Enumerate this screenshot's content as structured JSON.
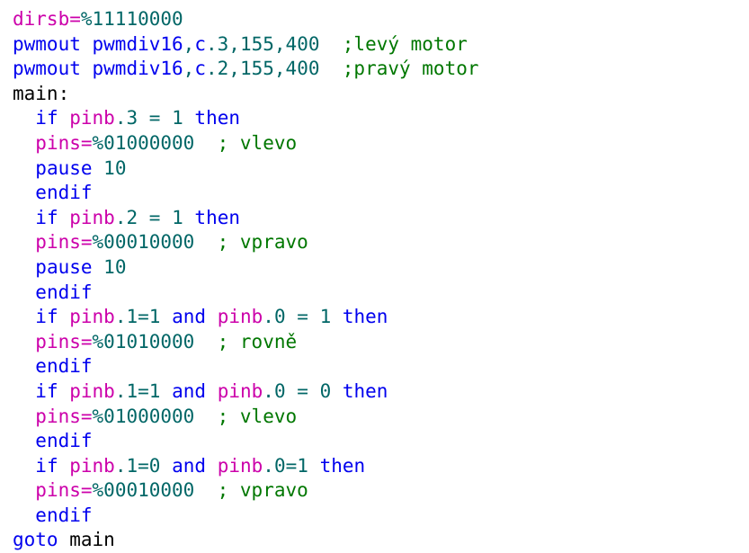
{
  "editor": {
    "language": "PICAXE BASIC",
    "background_color": "#ffffff",
    "font_size_px": 21,
    "line_height_px": 27.6,
    "colors": {
      "plain": "#000000",
      "keyword": "#0000EE",
      "identifier": "#CC00AA",
      "number": "#006666",
      "comment": "#007700"
    }
  },
  "code": {
    "line_count": 21,
    "lines": [
      {
        "n": 1,
        "text": "dirsb=%11110000",
        "tokens": [
          {
            "t": "dirsb",
            "c": "ident"
          },
          {
            "t": "=",
            "c": "ident"
          },
          {
            "t": "%11110000",
            "c": "number"
          }
        ]
      },
      {
        "n": 2,
        "text": "pwmout pwmdiv16,c.3,155,400  ;levý motor",
        "tokens": [
          {
            "t": "pwmout",
            "c": "keyword"
          },
          {
            "t": " ",
            "c": "plain"
          },
          {
            "t": "pwmdiv16",
            "c": "keyword"
          },
          {
            "t": ",",
            "c": "number"
          },
          {
            "t": "c",
            "c": "keyword"
          },
          {
            "t": ".",
            "c": "number"
          },
          {
            "t": "3",
            "c": "number"
          },
          {
            "t": ",",
            "c": "number"
          },
          {
            "t": "155",
            "c": "number"
          },
          {
            "t": ",",
            "c": "number"
          },
          {
            "t": "400",
            "c": "number"
          },
          {
            "t": "  ",
            "c": "plain"
          },
          {
            "t": ";levý motor",
            "c": "comment"
          }
        ]
      },
      {
        "n": 3,
        "text": "pwmout pwmdiv16,c.2,155,400  ;pravý motor",
        "tokens": [
          {
            "t": "pwmout",
            "c": "keyword"
          },
          {
            "t": " ",
            "c": "plain"
          },
          {
            "t": "pwmdiv16",
            "c": "keyword"
          },
          {
            "t": ",",
            "c": "number"
          },
          {
            "t": "c",
            "c": "keyword"
          },
          {
            "t": ".",
            "c": "number"
          },
          {
            "t": "2",
            "c": "number"
          },
          {
            "t": ",",
            "c": "number"
          },
          {
            "t": "155",
            "c": "number"
          },
          {
            "t": ",",
            "c": "number"
          },
          {
            "t": "400",
            "c": "number"
          },
          {
            "t": "  ",
            "c": "plain"
          },
          {
            "t": ";pravý motor",
            "c": "comment"
          }
        ]
      },
      {
        "n": 4,
        "text": "main:",
        "tokens": [
          {
            "t": "main:",
            "c": "plain"
          }
        ]
      },
      {
        "n": 5,
        "text": "  if pinb.3 = 1 then",
        "tokens": [
          {
            "t": "  ",
            "c": "plain"
          },
          {
            "t": "if",
            "c": "keyword"
          },
          {
            "t": " ",
            "c": "plain"
          },
          {
            "t": "pinb",
            "c": "ident"
          },
          {
            "t": ".",
            "c": "number"
          },
          {
            "t": "3",
            "c": "number"
          },
          {
            "t": " ",
            "c": "plain"
          },
          {
            "t": "=",
            "c": "number"
          },
          {
            "t": " ",
            "c": "plain"
          },
          {
            "t": "1",
            "c": "number"
          },
          {
            "t": " ",
            "c": "plain"
          },
          {
            "t": "then",
            "c": "keyword"
          }
        ]
      },
      {
        "n": 6,
        "text": "  pins=%01000000  ; vlevo",
        "tokens": [
          {
            "t": "  ",
            "c": "plain"
          },
          {
            "t": "pins",
            "c": "ident"
          },
          {
            "t": "=",
            "c": "ident"
          },
          {
            "t": "%01000000",
            "c": "number"
          },
          {
            "t": "  ",
            "c": "plain"
          },
          {
            "t": "; vlevo",
            "c": "comment"
          }
        ]
      },
      {
        "n": 7,
        "text": "  pause 10",
        "tokens": [
          {
            "t": "  ",
            "c": "plain"
          },
          {
            "t": "pause",
            "c": "keyword"
          },
          {
            "t": " ",
            "c": "plain"
          },
          {
            "t": "10",
            "c": "number"
          }
        ]
      },
      {
        "n": 8,
        "text": "  endif",
        "tokens": [
          {
            "t": "  ",
            "c": "plain"
          },
          {
            "t": "endif",
            "c": "keyword"
          }
        ]
      },
      {
        "n": 9,
        "text": "  if pinb.2 = 1 then",
        "tokens": [
          {
            "t": "  ",
            "c": "plain"
          },
          {
            "t": "if",
            "c": "keyword"
          },
          {
            "t": " ",
            "c": "plain"
          },
          {
            "t": "pinb",
            "c": "ident"
          },
          {
            "t": ".",
            "c": "number"
          },
          {
            "t": "2",
            "c": "number"
          },
          {
            "t": " ",
            "c": "plain"
          },
          {
            "t": "=",
            "c": "number"
          },
          {
            "t": " ",
            "c": "plain"
          },
          {
            "t": "1",
            "c": "number"
          },
          {
            "t": " ",
            "c": "plain"
          },
          {
            "t": "then",
            "c": "keyword"
          }
        ]
      },
      {
        "n": 10,
        "text": "  pins=%00010000  ; vpravo",
        "tokens": [
          {
            "t": "  ",
            "c": "plain"
          },
          {
            "t": "pins",
            "c": "ident"
          },
          {
            "t": "=",
            "c": "ident"
          },
          {
            "t": "%00010000",
            "c": "number"
          },
          {
            "t": "  ",
            "c": "plain"
          },
          {
            "t": "; vpravo",
            "c": "comment"
          }
        ]
      },
      {
        "n": 11,
        "text": "  pause 10",
        "tokens": [
          {
            "t": "  ",
            "c": "plain"
          },
          {
            "t": "pause",
            "c": "keyword"
          },
          {
            "t": " ",
            "c": "plain"
          },
          {
            "t": "10",
            "c": "number"
          }
        ]
      },
      {
        "n": 12,
        "text": "  endif",
        "tokens": [
          {
            "t": "  ",
            "c": "plain"
          },
          {
            "t": "endif",
            "c": "keyword"
          }
        ]
      },
      {
        "n": 13,
        "text": "  if pinb.1=1 and pinb.0 = 1 then",
        "tokens": [
          {
            "t": "  ",
            "c": "plain"
          },
          {
            "t": "if",
            "c": "keyword"
          },
          {
            "t": " ",
            "c": "plain"
          },
          {
            "t": "pinb",
            "c": "ident"
          },
          {
            "t": ".",
            "c": "number"
          },
          {
            "t": "1",
            "c": "number"
          },
          {
            "t": "=",
            "c": "number"
          },
          {
            "t": "1",
            "c": "number"
          },
          {
            "t": " ",
            "c": "plain"
          },
          {
            "t": "and",
            "c": "keyword"
          },
          {
            "t": " ",
            "c": "plain"
          },
          {
            "t": "pinb",
            "c": "ident"
          },
          {
            "t": ".",
            "c": "number"
          },
          {
            "t": "0",
            "c": "number"
          },
          {
            "t": " ",
            "c": "plain"
          },
          {
            "t": "=",
            "c": "number"
          },
          {
            "t": " ",
            "c": "plain"
          },
          {
            "t": "1",
            "c": "number"
          },
          {
            "t": " ",
            "c": "plain"
          },
          {
            "t": "then",
            "c": "keyword"
          }
        ]
      },
      {
        "n": 14,
        "text": "  pins=%01010000  ; rovně",
        "tokens": [
          {
            "t": "  ",
            "c": "plain"
          },
          {
            "t": "pins",
            "c": "ident"
          },
          {
            "t": "=",
            "c": "ident"
          },
          {
            "t": "%01010000",
            "c": "number"
          },
          {
            "t": "  ",
            "c": "plain"
          },
          {
            "t": "; rovně",
            "c": "comment"
          }
        ]
      },
      {
        "n": 15,
        "text": "  endif",
        "tokens": [
          {
            "t": "  ",
            "c": "plain"
          },
          {
            "t": "endif",
            "c": "keyword"
          }
        ]
      },
      {
        "n": 16,
        "text": "  if pinb.1=1 and pinb.0 = 0 then",
        "tokens": [
          {
            "t": "  ",
            "c": "plain"
          },
          {
            "t": "if",
            "c": "keyword"
          },
          {
            "t": " ",
            "c": "plain"
          },
          {
            "t": "pinb",
            "c": "ident"
          },
          {
            "t": ".",
            "c": "number"
          },
          {
            "t": "1",
            "c": "number"
          },
          {
            "t": "=",
            "c": "number"
          },
          {
            "t": "1",
            "c": "number"
          },
          {
            "t": " ",
            "c": "plain"
          },
          {
            "t": "and",
            "c": "keyword"
          },
          {
            "t": " ",
            "c": "plain"
          },
          {
            "t": "pinb",
            "c": "ident"
          },
          {
            "t": ".",
            "c": "number"
          },
          {
            "t": "0",
            "c": "number"
          },
          {
            "t": " ",
            "c": "plain"
          },
          {
            "t": "=",
            "c": "number"
          },
          {
            "t": " ",
            "c": "plain"
          },
          {
            "t": "0",
            "c": "number"
          },
          {
            "t": " ",
            "c": "plain"
          },
          {
            "t": "then",
            "c": "keyword"
          }
        ]
      },
      {
        "n": 17,
        "text": "  pins=%01000000  ; vlevo",
        "tokens": [
          {
            "t": "  ",
            "c": "plain"
          },
          {
            "t": "pins",
            "c": "ident"
          },
          {
            "t": "=",
            "c": "ident"
          },
          {
            "t": "%01000000",
            "c": "number"
          },
          {
            "t": "  ",
            "c": "plain"
          },
          {
            "t": "; vlevo",
            "c": "comment"
          }
        ]
      },
      {
        "n": 18,
        "text": "  endif",
        "tokens": [
          {
            "t": "  ",
            "c": "plain"
          },
          {
            "t": "endif",
            "c": "keyword"
          }
        ]
      },
      {
        "n": 19,
        "text": "  if pinb.1=0 and pinb.0=1 then",
        "tokens": [
          {
            "t": "  ",
            "c": "plain"
          },
          {
            "t": "if",
            "c": "keyword"
          },
          {
            "t": " ",
            "c": "plain"
          },
          {
            "t": "pinb",
            "c": "ident"
          },
          {
            "t": ".",
            "c": "number"
          },
          {
            "t": "1",
            "c": "number"
          },
          {
            "t": "=",
            "c": "number"
          },
          {
            "t": "0",
            "c": "number"
          },
          {
            "t": " ",
            "c": "plain"
          },
          {
            "t": "and",
            "c": "keyword"
          },
          {
            "t": " ",
            "c": "plain"
          },
          {
            "t": "pinb",
            "c": "ident"
          },
          {
            "t": ".",
            "c": "number"
          },
          {
            "t": "0",
            "c": "number"
          },
          {
            "t": "=",
            "c": "number"
          },
          {
            "t": "1",
            "c": "number"
          },
          {
            "t": " ",
            "c": "plain"
          },
          {
            "t": "then",
            "c": "keyword"
          }
        ]
      },
      {
        "n": 20,
        "text": "  pins=%00010000  ; vpravo",
        "tokens": [
          {
            "t": "  ",
            "c": "plain"
          },
          {
            "t": "pins",
            "c": "ident"
          },
          {
            "t": "=",
            "c": "ident"
          },
          {
            "t": "%00010000",
            "c": "number"
          },
          {
            "t": "  ",
            "c": "plain"
          },
          {
            "t": "; vpravo",
            "c": "comment"
          }
        ]
      },
      {
        "n": 21,
        "text": "  endif",
        "tokens": [
          {
            "t": "  ",
            "c": "plain"
          },
          {
            "t": "endif",
            "c": "keyword"
          }
        ]
      },
      {
        "n": 22,
        "text": "goto main",
        "tokens": [
          {
            "t": "goto",
            "c": "keyword"
          },
          {
            "t": " ",
            "c": "plain"
          },
          {
            "t": "main",
            "c": "plain"
          }
        ]
      }
    ]
  }
}
